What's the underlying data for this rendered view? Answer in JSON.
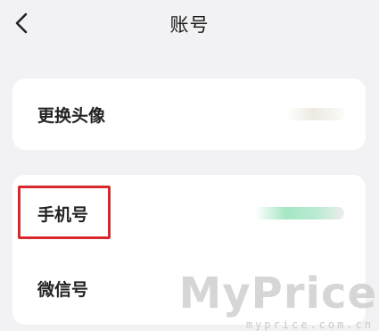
{
  "header": {
    "title": "账号",
    "back_icon": "chevron-left-icon"
  },
  "rows": {
    "avatar": {
      "label": "更换头像"
    },
    "phone": {
      "label": "手机号"
    },
    "wechat": {
      "label": "微信号"
    }
  },
  "colors": {
    "highlight": "#d8282c",
    "phone_value_tint": "#8ee0b6"
  },
  "watermark": {
    "brand": "MyPrice",
    "url": "myprice.com.cn"
  }
}
